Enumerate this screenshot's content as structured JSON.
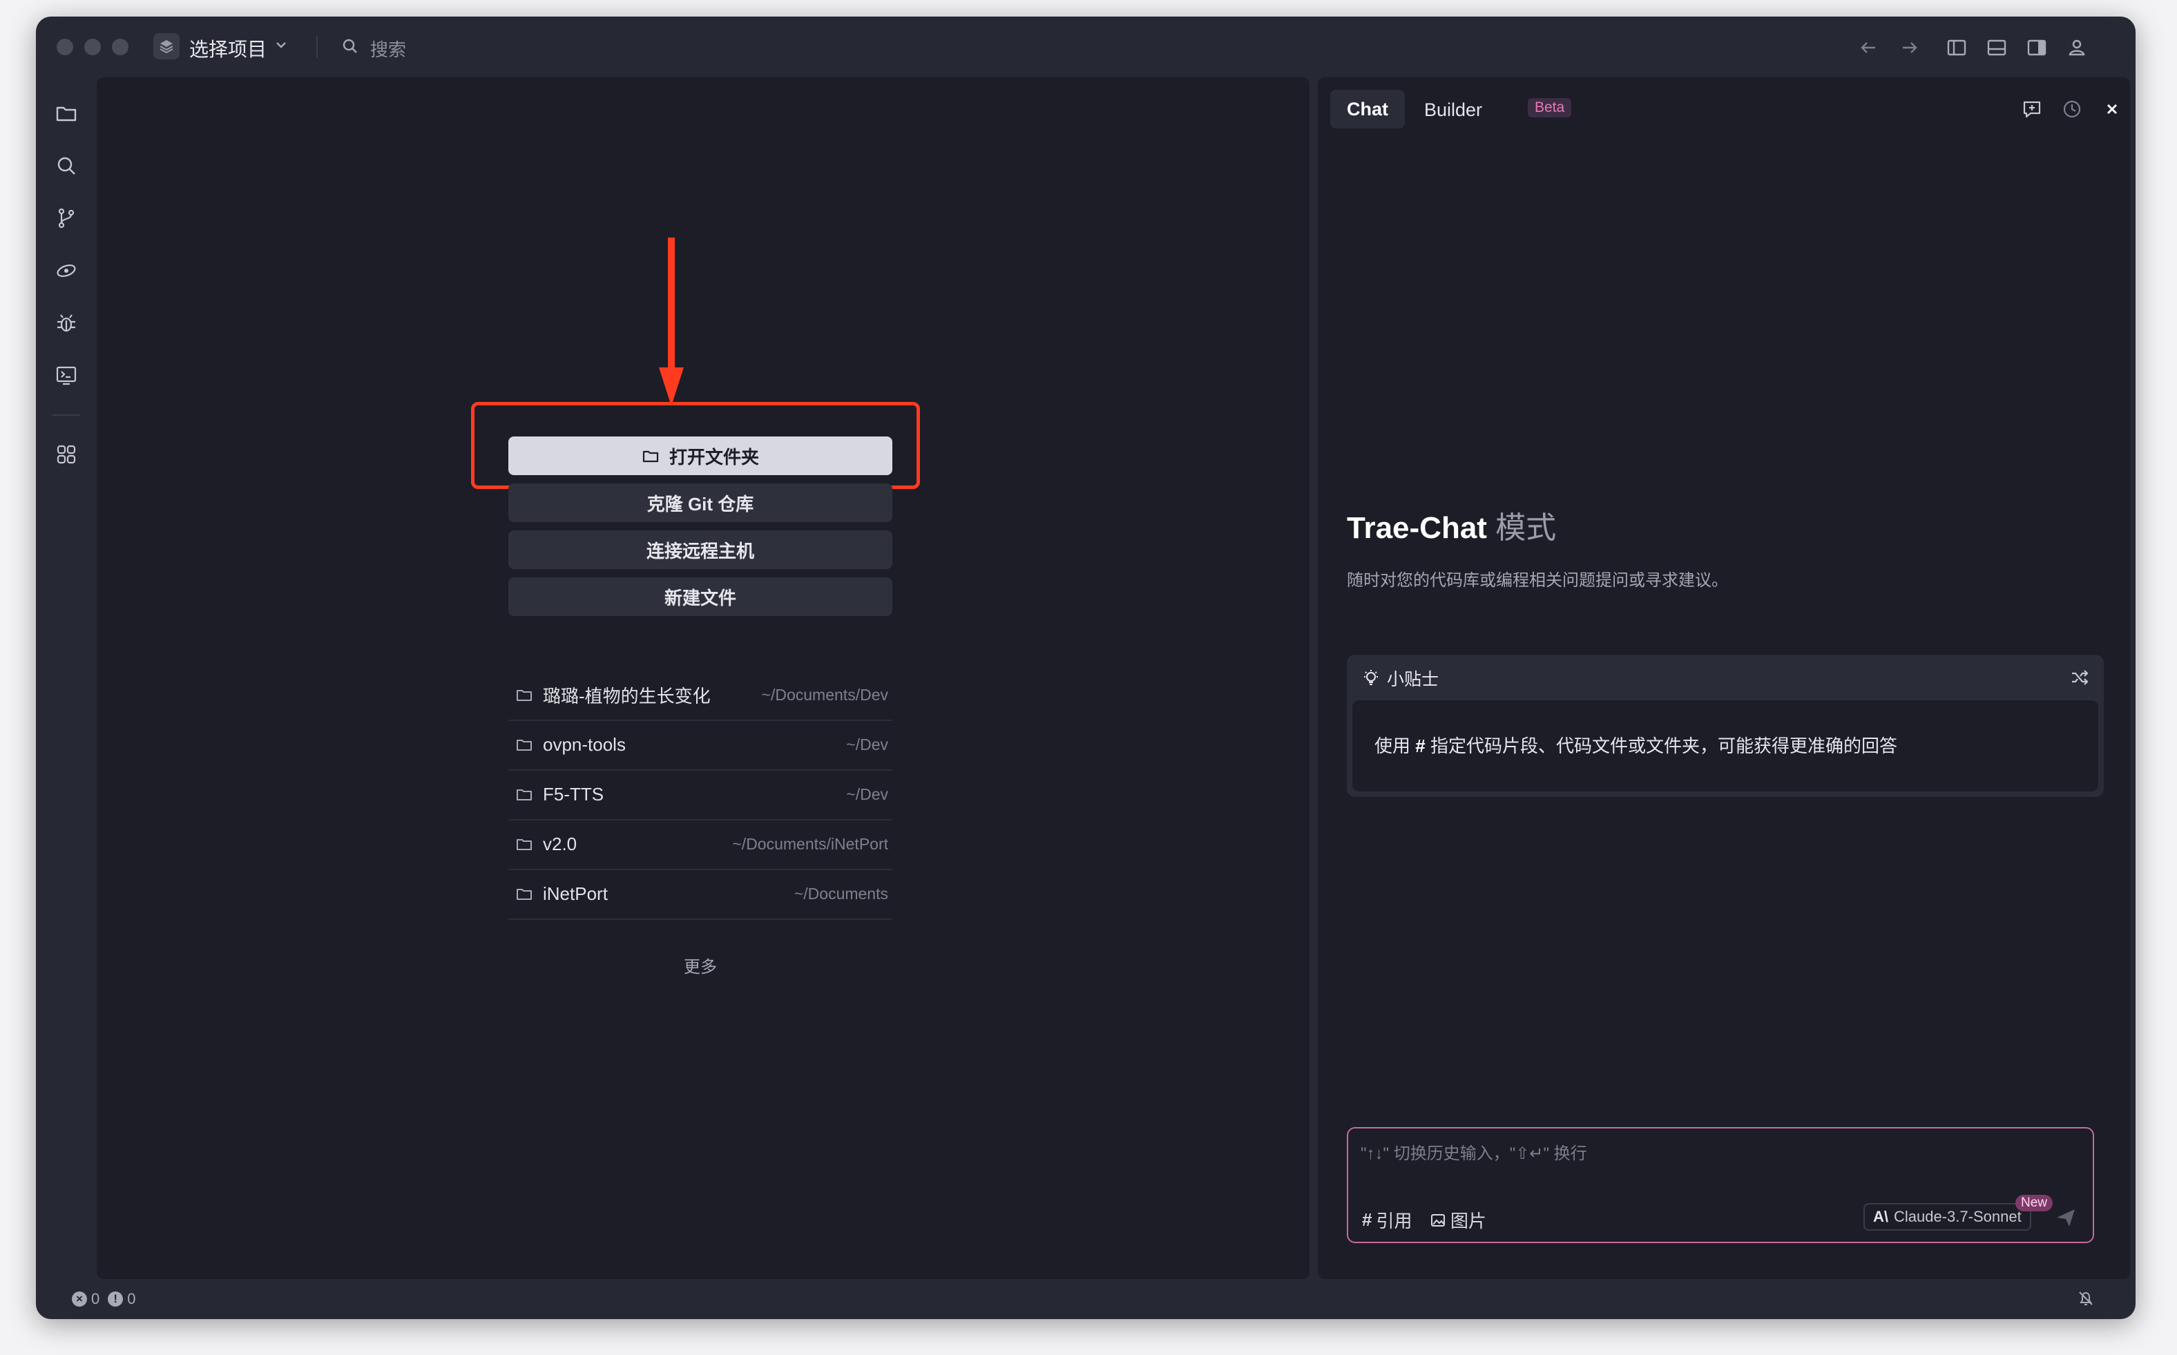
{
  "titlebar": {
    "project_label": "选择项目",
    "search_placeholder": "搜索"
  },
  "welcome": {
    "actions": {
      "open_folder": "打开文件夹",
      "clone_git": "克隆 Git 仓库",
      "connect_remote": "连接远程主机",
      "new_file": "新建文件"
    },
    "recent": [
      {
        "name": "璐璐-植物的生长变化",
        "path": "~/Documents/Dev"
      },
      {
        "name": "ovpn-tools",
        "path": "~/Dev"
      },
      {
        "name": "F5-TTS",
        "path": "~/Dev"
      },
      {
        "name": "v2.0",
        "path": "~/Documents/iNetPort"
      },
      {
        "name": "iNetPort",
        "path": "~/Documents"
      }
    ],
    "more_label": "更多"
  },
  "chat": {
    "tabs": {
      "chat": "Chat",
      "builder": "Builder",
      "beta": "Beta"
    },
    "mode_title": "Trae-Chat",
    "mode_suffix": "模式",
    "subtitle": "随时对您的代码库或编程相关问题提问或寻求建议。",
    "tips": {
      "title": "小贴士",
      "body_prefix": "使用",
      "body_hash": "#",
      "body_rest": "指定代码片段、代码文件或文件夹，可能获得更准确的回答"
    },
    "input": {
      "placeholder": "\"↑↓\" 切换历史输入，\"⇧↵\" 换行",
      "reference_label": "引用",
      "image_label": "图片",
      "model_label": "Claude-3.7-Sonnet",
      "new_badge": "New"
    }
  },
  "statusbar": {
    "errors": "0",
    "warnings": "0"
  },
  "colors": {
    "accent_highlight": "#ff3b1f",
    "beta_text": "#e87ab8",
    "input_border": "#c96a9c"
  }
}
